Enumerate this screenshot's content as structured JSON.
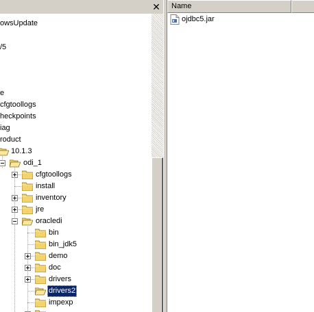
{
  "tree": {
    "items": [
      {
        "label": "owsUpdate"
      },
      {
        "label": "/5"
      },
      {
        "label": "e"
      },
      {
        "label": "cfgtoollogs"
      },
      {
        "label": "heckpoints"
      },
      {
        "label": "iag"
      },
      {
        "label": "roduct"
      },
      {
        "label": "10.1.3"
      },
      {
        "label": "odi_1"
      },
      {
        "label": "cfgtoollogs"
      },
      {
        "label": "install"
      },
      {
        "label": "inventory"
      },
      {
        "label": "jre"
      },
      {
        "label": "oracledi"
      },
      {
        "label": "bin"
      },
      {
        "label": "bin_jdk5"
      },
      {
        "label": "demo"
      },
      {
        "label": "doc"
      },
      {
        "label": "drivers"
      },
      {
        "label": "drivers2"
      },
      {
        "label": "impexp"
      }
    ],
    "selected": "drivers2"
  },
  "file_list": {
    "columns": [
      {
        "label": "Name"
      }
    ],
    "files": [
      {
        "name": "ojdbc5.jar",
        "icon": "jar-file-icon"
      }
    ]
  },
  "colors": {
    "folder": "#f3d36b",
    "selection": "#0a246a",
    "window": "#d4d0c8"
  }
}
